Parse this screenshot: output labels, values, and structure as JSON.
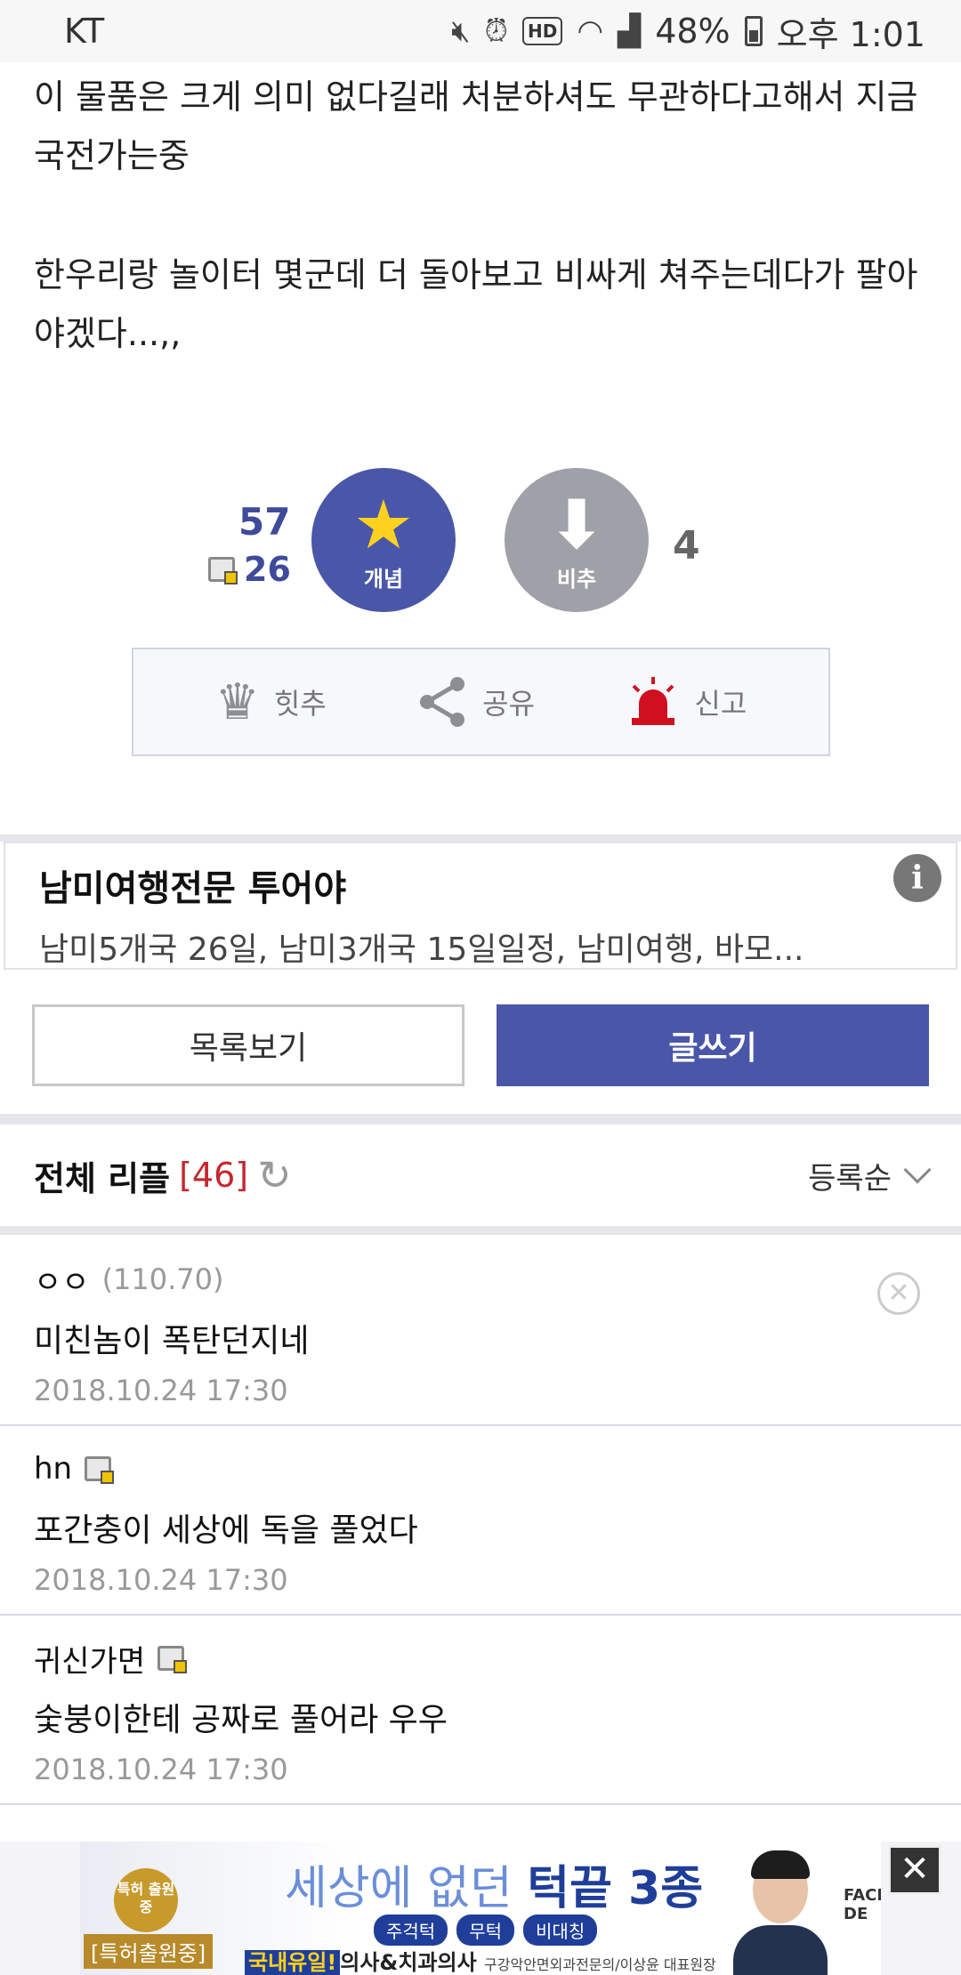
{
  "status_bar": {
    "carrier": "KT",
    "battery_percent": "48%",
    "time": "오후 1:01",
    "hd_label": "HD",
    "icons": [
      "mute-icon",
      "alarm-icon",
      "hd-icon",
      "wifi-icon",
      "signal-icon",
      "battery-icon"
    ]
  },
  "article": {
    "paragraphs": [
      "이 물품은 크게 의미 없다길래 처분하셔도 무관하다고해서 지금 국전가는중",
      "한우리랑 놀이터 몇군데 더 돌아보고 비싸게 쳐주는데다가 팔아야겠다...,,"
    ]
  },
  "votes": {
    "up_count": "57",
    "fixed_count": "26",
    "up_label": "개념",
    "down_label": "비추",
    "down_count": "4"
  },
  "actions": {
    "hit_label": "힛추",
    "share_label": "공유",
    "report_label": "신고"
  },
  "ad_banner": {
    "title": "남미여행전문 투어야",
    "description": "남미5개국 26일, 남미3개국 15일일정, 남미여행, 바모...",
    "info_glyph": "i"
  },
  "buttons": {
    "list_label": "목록보기",
    "write_label": "글쓰기"
  },
  "comments_header": {
    "title": "전체 리플",
    "count": "[46]",
    "sort_label": "등록순"
  },
  "comments": [
    {
      "author": "ㅇㅇ",
      "ip": "(110.70)",
      "text": "미친놈이 폭탄던지네",
      "date": "2018.10.24 17:30",
      "fixed_user": false,
      "deletable": true
    },
    {
      "author": "hn",
      "ip": "",
      "text": "포간충이 세상에 독을 풀었다",
      "date": "2018.10.24 17:30",
      "fixed_user": true,
      "deletable": false
    },
    {
      "author": "귀신가면",
      "ip": "",
      "text": "숯붕이한테 공짜로 풀어라 우우",
      "date": "2018.10.24 17:30",
      "fixed_user": true,
      "deletable": false
    }
  ],
  "bottom_ad": {
    "badge_text": "특허 출원중",
    "badge_label": "[특허출원중]",
    "headline_light": "세상에 없던 ",
    "headline_bold": "턱끝 3종",
    "tags": [
      "주걱턱",
      "무턱",
      "비대칭"
    ],
    "footer_highlight": "국내유일!",
    "footer_text": "의사&치과의사",
    "footer_small": "구강악안면외과전문의/이상윤 대표원장",
    "logo_text": "FACE DE",
    "close_glyph": "✕"
  }
}
